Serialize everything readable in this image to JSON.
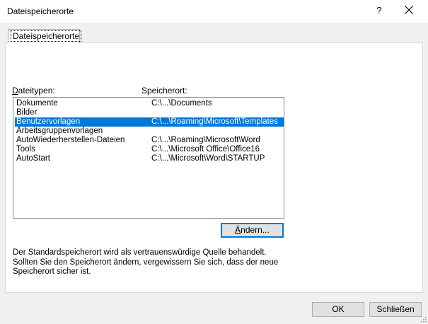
{
  "window": {
    "title": "Dateispeicherorte",
    "help_glyph": "?",
    "close_icon": "close-icon"
  },
  "tab": {
    "label": "Dateispeicherorte"
  },
  "columns": {
    "type_prefix": "D",
    "type_rest": "ateitypen:",
    "location": "Speicherort:"
  },
  "rows": [
    {
      "type": "Dokumente",
      "path": "C:\\...\\Documents",
      "selected": false
    },
    {
      "type": "Bilder",
      "path": "",
      "selected": false
    },
    {
      "type": "Benutzervorlagen",
      "path": "C:\\...\\Roaming\\Microsoft\\Templates",
      "selected": true
    },
    {
      "type": "Arbeitsgruppenvorlagen",
      "path": "",
      "selected": false
    },
    {
      "type": "AutoWiederherstellen-Dateien",
      "path": "C:\\...\\Roaming\\Microsoft\\Word",
      "selected": false
    },
    {
      "type": "Tools",
      "path": "C:\\...\\Microsoft Office\\Office16",
      "selected": false
    },
    {
      "type": "AutoStart",
      "path": "C:\\...\\Microsoft\\Word\\STARTUP",
      "selected": false
    }
  ],
  "buttons": {
    "change_prefix": "Ä",
    "change_rest": "ndern...",
    "ok": "OK",
    "close": "Schließen"
  },
  "info": {
    "line1": "Der Standardspeicherort wird als vertrauenswürdige Quelle behandelt.",
    "line2": "Sollten Sie den Speicherort ändern, vergewissern Sie sich, dass der neue",
    "line3": "Speicherort sicher ist."
  },
  "colors": {
    "selection": "#0078d7",
    "dialog_bg": "#f0f0f0",
    "button_bg": "#e1e1e1"
  }
}
